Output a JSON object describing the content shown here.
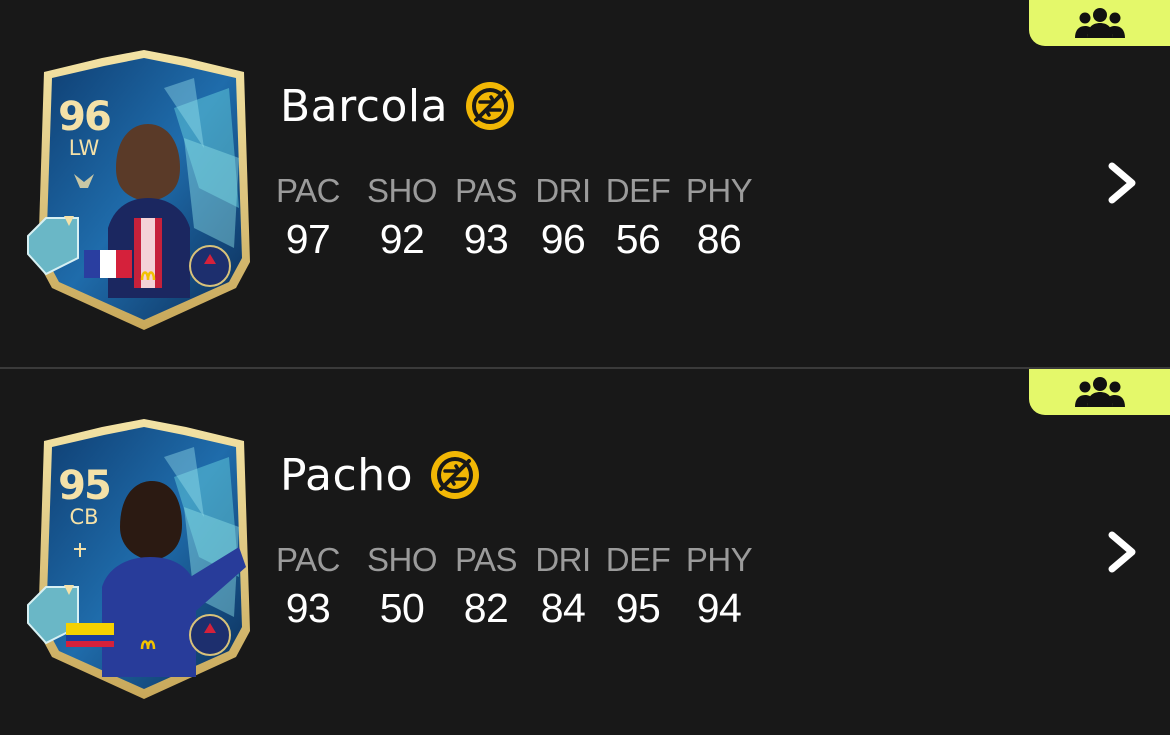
{
  "players": [
    {
      "name": "Barcola",
      "rating": "96",
      "position": "LW",
      "stats": [
        {
          "label": "PAC",
          "value": "97"
        },
        {
          "label": "SHO",
          "value": "92"
        },
        {
          "label": "PAS",
          "value": "93"
        },
        {
          "label": "DRI",
          "value": "96"
        },
        {
          "label": "DEF",
          "value": "56"
        },
        {
          "label": "PHY",
          "value": "86"
        }
      ],
      "nation_flag_icon": "france-flag-icon",
      "club_badge_icon": "psg-badge-icon"
    },
    {
      "name": "Pacho",
      "rating": "95",
      "position": "CB",
      "stats": [
        {
          "label": "PAC",
          "value": "93"
        },
        {
          "label": "SHO",
          "value": "50"
        },
        {
          "label": "PAS",
          "value": "82"
        },
        {
          "label": "DRI",
          "value": "84"
        },
        {
          "label": "DEF",
          "value": "95"
        },
        {
          "label": "PHY",
          "value": "94"
        }
      ],
      "nation_flag_icon": "ecuador-flag-icon",
      "club_badge_icon": "psg-badge-icon"
    }
  ],
  "colors": {
    "background": "#181818",
    "badge": "#e4f86a",
    "untradeable": "#f2b705",
    "stat_label": "#9b9b9b",
    "card_gold": "#d8c27a",
    "card_blue": "#1f5fa0"
  },
  "icons": {
    "badge": "group-icon",
    "untradeable": "untradeable-icon",
    "chevron": "chevron-right-icon"
  }
}
